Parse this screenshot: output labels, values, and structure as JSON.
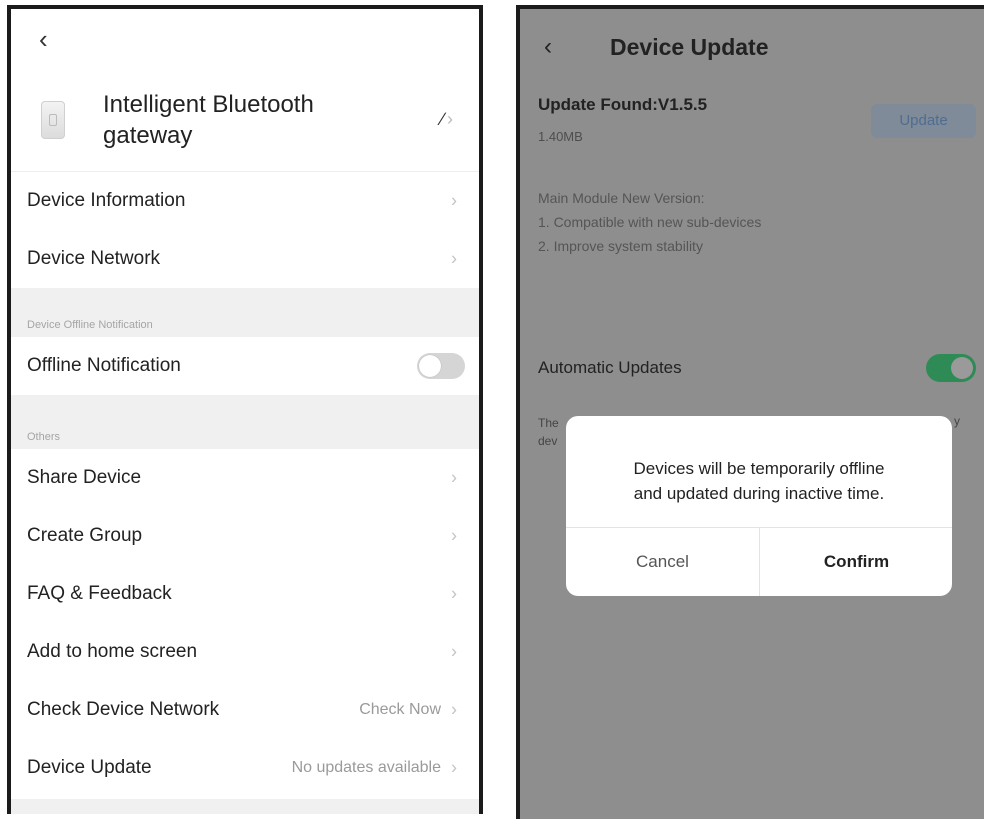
{
  "left": {
    "back_icon": "chevron-left-icon",
    "device_name": "Intelligent Bluetooth gateway",
    "rows_top": [
      {
        "label": "Device Information"
      },
      {
        "label": "Device Network"
      }
    ],
    "section_offline": "Device Offline Notification",
    "offline_label": "Offline Notification",
    "offline_toggle": "off",
    "section_others": "Others",
    "rows_others": [
      {
        "label": "Share Device"
      },
      {
        "label": "Create Group"
      },
      {
        "label": "FAQ & Feedback"
      },
      {
        "label": "Add to home screen"
      }
    ],
    "check_network": {
      "label": "Check Device Network",
      "value": "Check Now"
    },
    "device_update": {
      "label": "Device Update",
      "value": "No updates available"
    }
  },
  "right": {
    "title": "Device Update",
    "update_found": "Update Found:V1.5.5",
    "size": "1.40MB",
    "update_button": "Update",
    "notes": [
      "Main Module New Version:",
      "1. Compatible with new sub-devices",
      "2. Improve system stability"
    ],
    "auto_updates": "Automatic Updates",
    "auto_toggle": "on",
    "desc_line1": "The",
    "desc_line2": "dev",
    "desc_tail": "y",
    "dialog": {
      "line1": "Devices will be temporarily offline",
      "line2": "and updated during inactive time.",
      "cancel": "Cancel",
      "confirm": "Confirm"
    }
  },
  "colors": {
    "toggle_on": "#2f8b55",
    "overlay": "#8e8e8e",
    "accent_text": "#4f6d90"
  }
}
